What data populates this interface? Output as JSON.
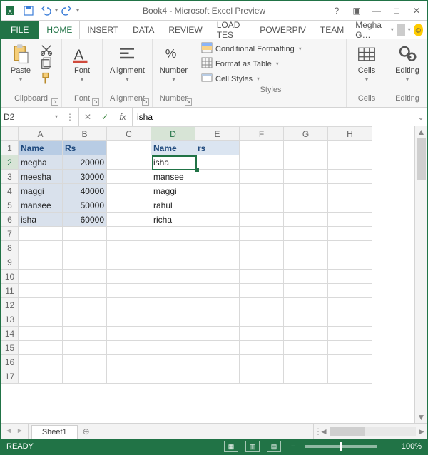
{
  "title": "Book4 - Microsoft Excel Preview",
  "tabs": {
    "file": "FILE",
    "items": [
      "HOME",
      "INSERT",
      "DATA",
      "REVIEW",
      "LOAD TES",
      "POWERPIV",
      "TEAM"
    ],
    "active": "HOME"
  },
  "user": "Megha G…",
  "ribbon": {
    "clipboard": {
      "paste": "Paste",
      "label": "Clipboard"
    },
    "font": {
      "btn": "Font",
      "label": "Font"
    },
    "alignment": {
      "btn": "Alignment",
      "label": "Alignment"
    },
    "number": {
      "btn": "Number",
      "label": "Number"
    },
    "styles": {
      "cond": "Conditional Formatting",
      "table": "Format as Table",
      "cell": "Cell Styles",
      "label": "Styles"
    },
    "cells": {
      "btn": "Cells",
      "label": "Cells"
    },
    "editing": {
      "btn": "Editing",
      "label": "Editing"
    }
  },
  "namebox": "D2",
  "formula": "isha",
  "columns": [
    "A",
    "B",
    "C",
    "D",
    "E",
    "F",
    "G",
    "H"
  ],
  "rows": 17,
  "selected": {
    "col": "D",
    "row": 2
  },
  "cells": {
    "A1": "Name",
    "B1": "Rs",
    "A2": "megha",
    "B2": "20000",
    "A3": "meesha",
    "B3": "30000",
    "A4": "maggi",
    "B4": "40000",
    "A5": "mansee",
    "B5": "50000",
    "A6": "isha",
    "B6": "60000",
    "D1": "Name",
    "E1": "rs",
    "D2": "isha",
    "D3": "mansee",
    "D4": "maggi",
    "D5": "rahul",
    "D6": "richa"
  },
  "sheet_tab": "Sheet1",
  "status": "READY",
  "zoom": "100%"
}
